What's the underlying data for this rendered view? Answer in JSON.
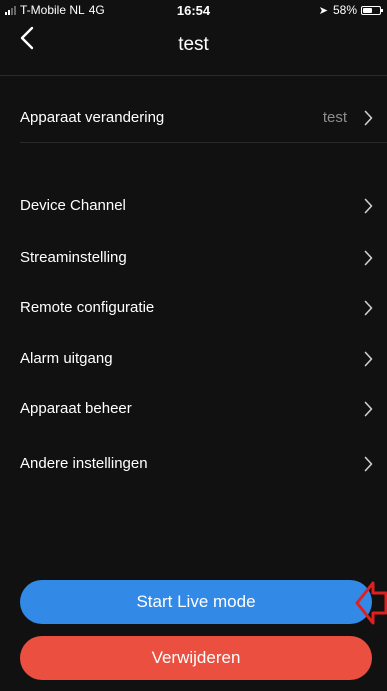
{
  "status_bar": {
    "carrier": "T-Mobile NL",
    "network": "4G",
    "time": "16:54",
    "battery": "58%",
    "battery_level": 0.58
  },
  "nav": {
    "title": "test",
    "back_icon": "chevron-left-icon"
  },
  "device_row": {
    "label": "Apparaat verandering",
    "value": "test"
  },
  "menu": {
    "items": [
      {
        "label": "Device Channel"
      },
      {
        "label": "Streaminstelling"
      },
      {
        "label": "Remote configuratie"
      },
      {
        "label": "Alarm uitgang"
      },
      {
        "label": "Apparaat beheer"
      },
      {
        "label": "Andere instellingen"
      }
    ]
  },
  "buttons": {
    "live_label": "Start Live mode",
    "delete_label": "Verwijderen"
  },
  "colors": {
    "background": "#111111",
    "primary": "#3389e6",
    "danger": "#ea4f40",
    "annotation": "#e02020"
  }
}
